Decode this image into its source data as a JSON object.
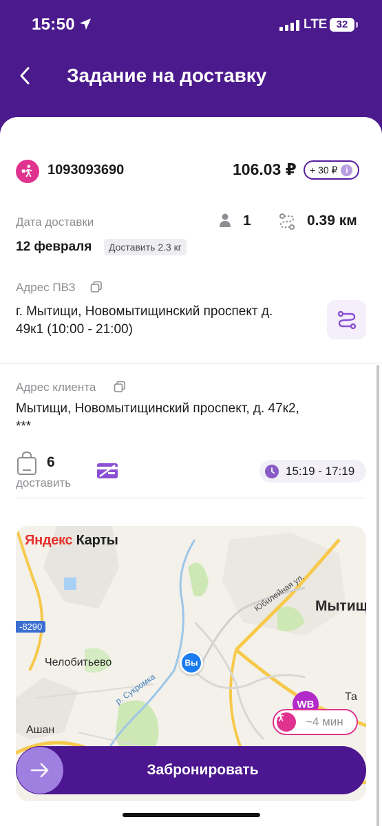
{
  "status_bar": {
    "time": "15:50",
    "network": "LTE",
    "battery": "32"
  },
  "header": {
    "title": "Задание на доставку"
  },
  "order": {
    "id": "1093093690",
    "price": "106.03 ₽",
    "bonus": "+ 30 ₽",
    "bonus_info": "i"
  },
  "delivery": {
    "date_label": "Дата доставки",
    "date_value": "12 февраля",
    "weight_badge": "Доставить 2.3 кг",
    "persons": "1",
    "distance": "0.39 км"
  },
  "pickup": {
    "label": "Адрес ПВЗ",
    "address_line1": "г. Мытищи, Новомытищинский проспект д.",
    "address_line2": "49к1 (10:00 - 21:00)"
  },
  "client": {
    "label": "Адрес клиента",
    "address_line1": "Мытищи, Новомытищинский проспект, д. 47к2,",
    "address_line2": "***"
  },
  "summary": {
    "items_count": "6",
    "items_caption": "доставить",
    "time_window": "15:19 - 17:19"
  },
  "map": {
    "logo_ya": "Яндекс",
    "logo_maps": " Карты",
    "places": {
      "chelobitevo": "Челобитьево",
      "mytishchi": "Мытищ",
      "ashan": "Ашан",
      "sukromka": "р. Сукромка",
      "yubileinaya": "Юбилейная ул.",
      "route": "-8290",
      "ta": "Та"
    },
    "me_label": "Вы",
    "wb_label": "WB",
    "eta": "~4 мин"
  },
  "actions": {
    "book_label": "Забронировать"
  },
  "colors": {
    "brand": "#4b1a8c",
    "accent_pink": "#e0338f",
    "accent_lilac": "#9f7fe0"
  }
}
